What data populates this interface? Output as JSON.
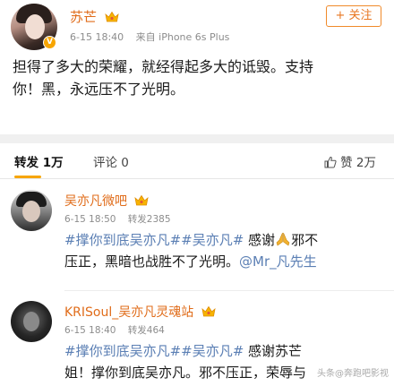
{
  "post": {
    "username": "苏芒",
    "time": "6-15 18:40",
    "source": "来自 iPhone 6s Plus",
    "follow_label": "+ 关注",
    "text_line1": "担得了多大的荣耀，就经得起多大的诋毁。支持",
    "text_line2": "你！黑，永远压不了光明。"
  },
  "tabs": {
    "repost_label": "转发 1万",
    "comment_label": "评论 0",
    "like_label": "赞 2万"
  },
  "reposts": [
    {
      "username": "吴亦凡微吧",
      "time": "6-15 18:50",
      "count": "转发2385",
      "tag1": "#撑你到底吴亦凡#",
      "tag2": "#吴亦凡#",
      "text_a": " 感谢",
      "text_b": "邪不",
      "line2": "压正，黑暗也战胜不了光明。",
      "mention": "@Mr_凡先生"
    },
    {
      "username": "KRISoul_吴亦凡灵魂站",
      "time": "6-15 18:40",
      "count": "转发464",
      "tag1": "#撑你到底吴亦凡#",
      "tag2": "#吴亦凡#",
      "text_a": " 感谢苏芒",
      "line2": "姐！撑你到底吴亦凡。邪不压正，荣辱与"
    }
  ],
  "watermark": "头条@奔跑吧影视",
  "colors": {
    "username": "#e06c1a",
    "hashtag": "#5b7fb4",
    "accent": "#f7a500",
    "meta": "#8c8c8c"
  },
  "icons": [
    "crown-icon",
    "verified-badge-icon",
    "thumb-up-icon",
    "praying-hands-icon"
  ]
}
